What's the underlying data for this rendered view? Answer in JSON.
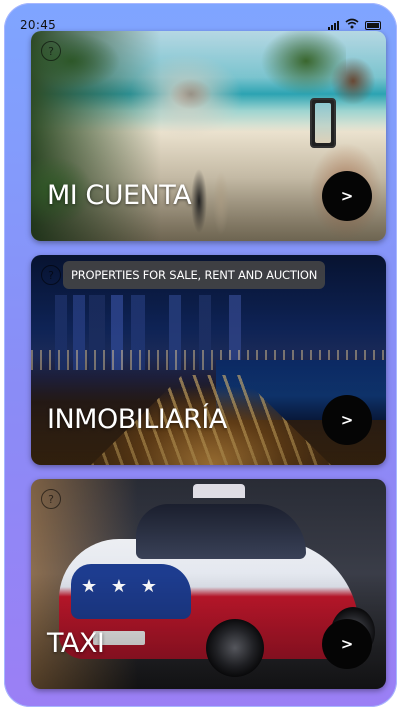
{
  "status_bar": {
    "time": "20:45"
  },
  "cards": [
    {
      "title": "MI CUENTA",
      "go_button_label": ">",
      "help_icon": "?",
      "tooltip": ""
    },
    {
      "title": "INMOBILIARÍA",
      "go_button_label": ">",
      "help_icon": "?",
      "tooltip": "PROPERTIES FOR SALE, RENT AND AUCTION"
    },
    {
      "title": "TAXI",
      "go_button_label": ">",
      "help_icon": "?",
      "tooltip": ""
    }
  ],
  "colors": {
    "frame_gradient_top": "#7fa5ff",
    "frame_gradient_bottom": "#9b7ff5",
    "button_bg": "#050505",
    "title_text": "#ffffff",
    "tooltip_bg": "#464646"
  },
  "icons": {
    "signal": "signal-icon",
    "wifi": "wifi-icon",
    "battery": "battery-icon",
    "help": "help-circle-icon",
    "arrow": "chevron-right-icon"
  }
}
